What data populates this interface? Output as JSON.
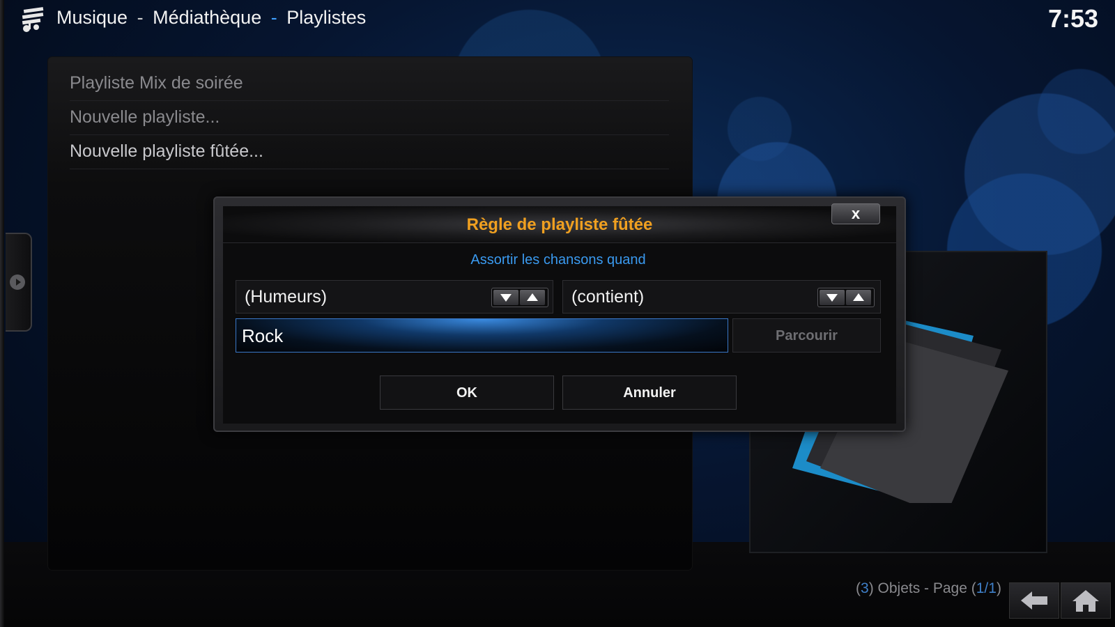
{
  "header": {
    "section": "Musique",
    "sep1": "-",
    "library": "Médiathèque",
    "sep2": "-",
    "page": "Playlistes",
    "clock": "7:53"
  },
  "list": {
    "items": [
      {
        "label": "Playliste Mix de soirée"
      },
      {
        "label": "Nouvelle playliste..."
      },
      {
        "label": "Nouvelle playliste fûtée..."
      }
    ]
  },
  "dialog": {
    "title": "Règle de playliste fûtée",
    "close_label": "x",
    "subtitle": "Assortir les chansons quand",
    "field": {
      "value": "(Humeurs)"
    },
    "operator": {
      "value": "(contient)"
    },
    "input_value": "Rock",
    "browse_label": "Parcourir",
    "ok_label": "OK",
    "cancel_label": "Annuler"
  },
  "footer": {
    "open_paren": "(",
    "count": "3",
    "mid_text": ") Objets - Page (",
    "page": "1/1",
    "close_paren": ")"
  },
  "icons": {
    "logo": "music-library-icon",
    "back": "back-arrow-icon",
    "home": "home-icon",
    "side": "play-circle-icon"
  },
  "colors": {
    "accent_blue": "#3a9af0",
    "title_orange": "#f0a020"
  }
}
